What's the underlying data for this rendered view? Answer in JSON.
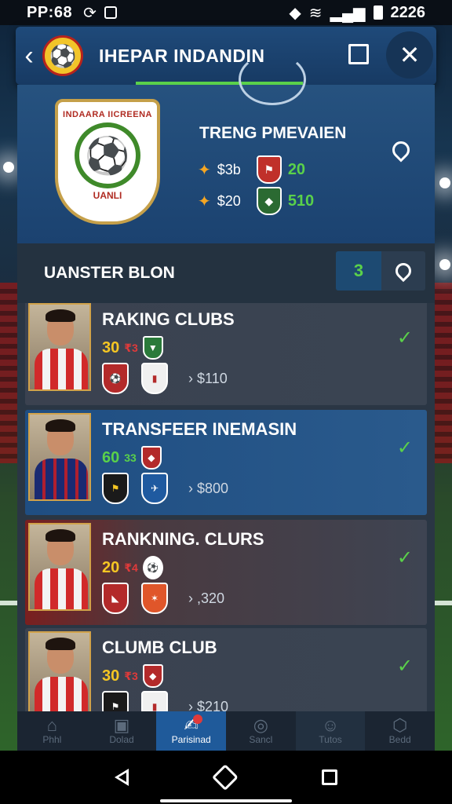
{
  "status_bar": {
    "left_text": "PP:68",
    "time": "2226"
  },
  "header": {
    "title": "IHEPAR INDANDIN"
  },
  "profile": {
    "crest_top": "INDAARA IICREENA",
    "crest_bottom": "UANLI",
    "title": "TRENG PMEVAIEN",
    "stats": [
      {
        "value": "$3b",
        "score": "20"
      },
      {
        "value": "$20",
        "score": "510"
      }
    ]
  },
  "section": {
    "title": "UANSTER BLON",
    "count": "3"
  },
  "cards": [
    {
      "name": "RAKING CLUBS",
      "rank": "30",
      "rank_sub": "₹3",
      "fee": "$110",
      "style": "dark"
    },
    {
      "name": "TRANSFEER INEMASIN",
      "rank": "60",
      "rank_sub": "33",
      "fee": "$800",
      "style": "blue"
    },
    {
      "name": "RANKNING. CLURS",
      "rank": "20",
      "rank_sub": "₹4",
      "fee": ",320",
      "style": "red"
    },
    {
      "name": "CLUMB CLUB",
      "rank": "30",
      "rank_sub": "₹3",
      "fee": "$210",
      "style": "dark"
    }
  ],
  "bottom_nav": [
    {
      "label": "Phhl",
      "icon": "home-icon"
    },
    {
      "label": "Dolad",
      "icon": "shirt-icon"
    },
    {
      "label": "Parisinad",
      "icon": "handshake-icon"
    },
    {
      "label": "Sancl",
      "icon": "ball-icon"
    },
    {
      "label": "Tutos",
      "icon": "person-icon"
    },
    {
      "label": "Bedd",
      "icon": "box-icon"
    }
  ],
  "colors": {
    "accent_green": "#5ad14a",
    "header_blue": "#1f4a7a",
    "active_tab": "#1f5a9a",
    "rank_yellow": "#f5c623"
  }
}
